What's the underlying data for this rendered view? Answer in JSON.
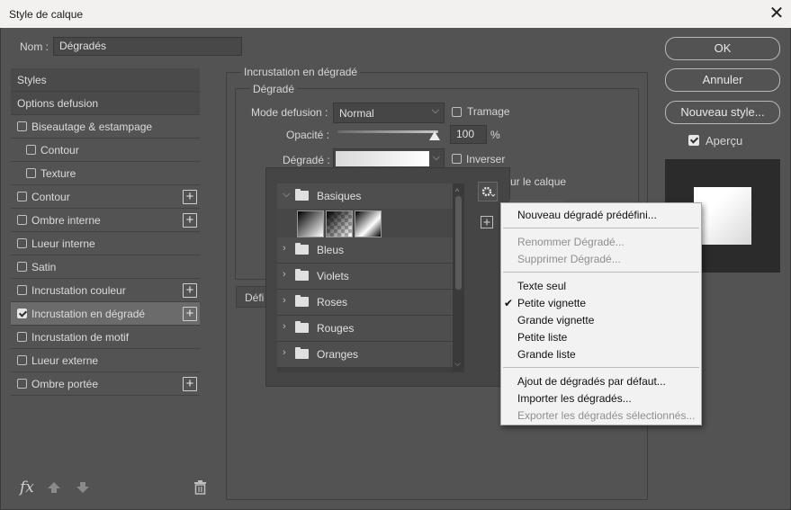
{
  "window": {
    "title": "Style de calque",
    "close_glyph": "✕"
  },
  "name_field": {
    "label": "Nom :",
    "value": "Dégradés"
  },
  "buttons": {
    "ok": "OK",
    "cancel": "Annuler",
    "new_style": "Nouveau style...",
    "preview_label": "Aperçu",
    "preview_checked": true
  },
  "styles_list": [
    {
      "label": "Styles",
      "checkbox": false,
      "plus": false,
      "indent": 0,
      "header": true
    },
    {
      "label": "Options defusion",
      "checkbox": false,
      "plus": false,
      "indent": 0,
      "header": true
    },
    {
      "label": "Biseautage & estampage",
      "checkbox": true,
      "checked": false,
      "plus": false,
      "indent": 0
    },
    {
      "label": "Contour",
      "checkbox": true,
      "checked": false,
      "plus": false,
      "indent": 1
    },
    {
      "label": "Texture",
      "checkbox": true,
      "checked": false,
      "plus": false,
      "indent": 1
    },
    {
      "label": "Contour",
      "checkbox": true,
      "checked": false,
      "plus": true,
      "indent": 0
    },
    {
      "label": "Ombre interne",
      "checkbox": true,
      "checked": false,
      "plus": true,
      "indent": 0
    },
    {
      "label": "Lueur interne",
      "checkbox": true,
      "checked": false,
      "plus": false,
      "indent": 0
    },
    {
      "label": "Satin",
      "checkbox": true,
      "checked": false,
      "plus": false,
      "indent": 0
    },
    {
      "label": "Incrustation couleur",
      "checkbox": true,
      "checked": false,
      "plus": true,
      "indent": 0
    },
    {
      "label": "Incrustation en dégradé",
      "checkbox": true,
      "checked": true,
      "plus": true,
      "indent": 0,
      "selected": true
    },
    {
      "label": "Incrustation de motif",
      "checkbox": true,
      "checked": false,
      "plus": false,
      "indent": 0
    },
    {
      "label": "Lueur externe",
      "checkbox": true,
      "checked": false,
      "plus": false,
      "indent": 0
    },
    {
      "label": "Ombre portée",
      "checkbox": true,
      "checked": false,
      "plus": true,
      "indent": 0
    }
  ],
  "bottom_icons": {
    "fx": "fx",
    "up": "arrow-up-icon",
    "down": "arrow-down-icon",
    "trash": "trash-icon"
  },
  "panel": {
    "section_title": "Incrustation en dégradé",
    "group_title": "Dégradé",
    "blend_label": "Mode defusion :",
    "blend_value": "Normal",
    "dither_label": "Tramage",
    "opacity_label": "Opacité :",
    "opacity_value": "100",
    "opacity_unit": "%",
    "gradient_label": "Dégradé :",
    "reverse_label": "Inverser",
    "align_partial": "ur le calque",
    "define_partial": "Défi"
  },
  "presets": {
    "folders": [
      {
        "name": "Basiques",
        "expanded": true
      },
      {
        "name": "Bleus",
        "expanded": false
      },
      {
        "name": "Violets",
        "expanded": false
      },
      {
        "name": "Roses",
        "expanded": false
      },
      {
        "name": "Rouges",
        "expanded": false
      },
      {
        "name": "Oranges",
        "expanded": false
      }
    ]
  },
  "menu": {
    "items": [
      {
        "label": "Nouveau dégradé prédéfini...",
        "disabled": false,
        "checked": false
      },
      {
        "label": "Renommer Dégradé...",
        "disabled": true,
        "checked": false
      },
      {
        "label": "Supprimer Dégradé...",
        "disabled": true,
        "checked": false
      },
      {
        "label": "Texte seul",
        "disabled": false,
        "checked": false
      },
      {
        "label": "Petite vignette",
        "disabled": false,
        "checked": true
      },
      {
        "label": "Grande vignette",
        "disabled": false,
        "checked": false
      },
      {
        "label": "Petite liste",
        "disabled": false,
        "checked": false
      },
      {
        "label": "Grande liste",
        "disabled": false,
        "checked": false
      },
      {
        "label": "Ajout de dégradés par défaut...",
        "disabled": false,
        "checked": false
      },
      {
        "label": "Importer les dégradés...",
        "disabled": false,
        "checked": false
      },
      {
        "label": "Exporter les dégradés sélectionnés...",
        "disabled": true,
        "checked": false
      }
    ],
    "check_glyph": "✔"
  }
}
